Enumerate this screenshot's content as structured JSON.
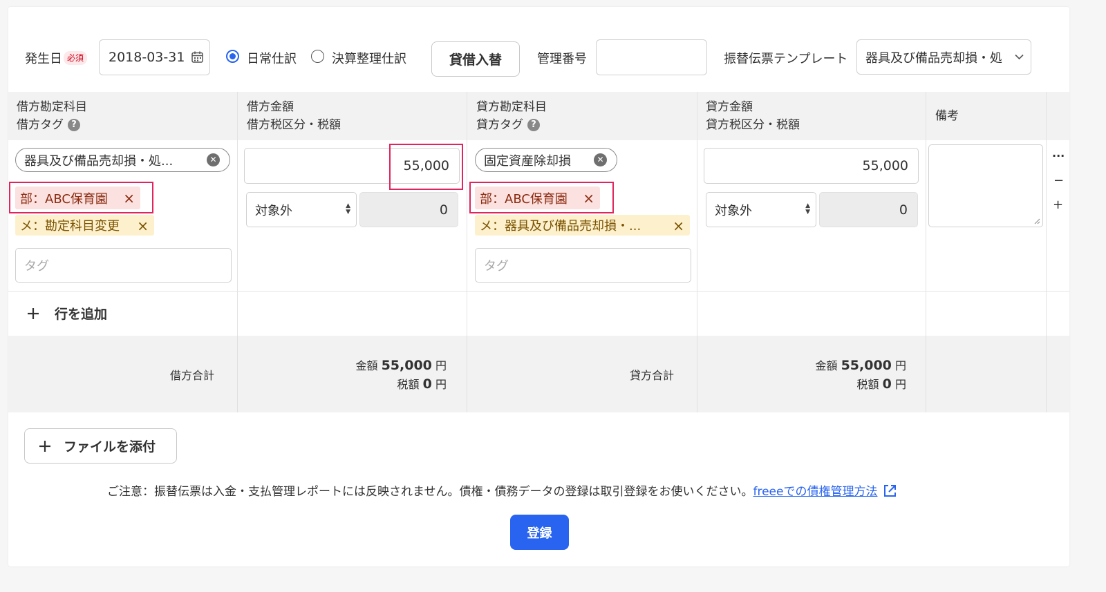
{
  "header": {
    "date_label": "発生日",
    "required_badge": "必須",
    "date_value": "2018-03-31",
    "radio_daily": "日常仕訳",
    "radio_closing": "決算整理仕訳",
    "swap_button": "貸借入替",
    "mgmt_no_label": "管理番号",
    "mgmt_no_value": "",
    "template_label": "振替伝票テンプレート",
    "template_value": "器具及び備品売却損・処"
  },
  "columns": {
    "debit_account": "借方勘定科目",
    "debit_tag": "借方タグ",
    "debit_amount": "借方金額",
    "debit_tax": "借方税区分・税額",
    "credit_account": "貸方勘定科目",
    "credit_tag": "貸方タグ",
    "credit_amount": "貸方金額",
    "credit_tax": "貸方税区分・税額",
    "remarks": "備考"
  },
  "row": {
    "debit_account_chip": "器具及び備品売却損・処...",
    "debit_tags": [
      "部：ABC保育園",
      "メ：勘定科目変更"
    ],
    "debit_tag_placeholder": "タグ",
    "debit_amount": "55,000",
    "debit_tax_select": "対象外",
    "debit_tax_amount": "0",
    "credit_account_chip": "固定資産除却損",
    "credit_tags": [
      "部：ABC保育園",
      "メ：器具及び備品売却損・..."
    ],
    "credit_tag_placeholder": "タグ",
    "credit_amount": "55,000",
    "credit_tax_select": "対象外",
    "credit_tax_amount": "0",
    "remarks": ""
  },
  "row_actions": {
    "more": "···",
    "remove": "−",
    "add": "+"
  },
  "add_row_label": "行を追加",
  "summary": {
    "debit_total_label": "借方合計",
    "credit_total_label": "貸方合計",
    "amount_label": "金額",
    "tax_label": "税額",
    "yen": "円",
    "debit_amount": "55,000",
    "debit_tax": "0",
    "credit_amount": "55,000",
    "credit_tax": "0"
  },
  "attach_button": "ファイルを添付",
  "notice_text": "ご注意：振替伝票は入金・支払管理レポートには反映されません。債権・債務データの登録は取引登録をお使いください。",
  "notice_link": "freeeでの債権管理方法",
  "submit_button": "登録",
  "colors": {
    "accent": "#2864f0",
    "highlight_box": "#e0245e"
  }
}
